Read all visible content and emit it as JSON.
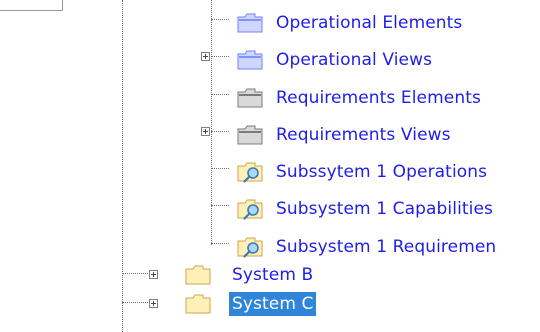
{
  "colors": {
    "link_text": "#1e1ee6",
    "selection_bg": "#2f86d8",
    "guide_line": "#707070",
    "folder_blue": "#cfd7ff",
    "folder_gray": "#d9d9d9",
    "folder_yellow": "#fff0b8"
  },
  "tree": {
    "items": [
      {
        "label": "Operational Elements",
        "icon": "blue-folder-icon",
        "expandable": false,
        "selected": false
      },
      {
        "label": "Operational Views",
        "icon": "blue-folder-icon",
        "expandable": true,
        "selected": false
      },
      {
        "label": "Requirements Elements",
        "icon": "gray-folder-icon",
        "expandable": false,
        "selected": false
      },
      {
        "label": "Requirements Views",
        "icon": "gray-folder-icon",
        "expandable": true,
        "selected": false
      },
      {
        "label": "Subssytem 1 Operations",
        "icon": "search-folder-icon",
        "expandable": false,
        "selected": false
      },
      {
        "label": "Subsystem 1 Capabilities",
        "icon": "search-folder-icon",
        "expandable": false,
        "selected": false
      },
      {
        "label": "Subsystem 1 Requiremen",
        "icon": "search-folder-icon",
        "expandable": false,
        "selected": false
      },
      {
        "label": "System B",
        "icon": "yellow-folder-icon",
        "expandable": true,
        "selected": false
      },
      {
        "label": "System C",
        "icon": "yellow-folder-icon",
        "expandable": true,
        "selected": true
      }
    ]
  }
}
